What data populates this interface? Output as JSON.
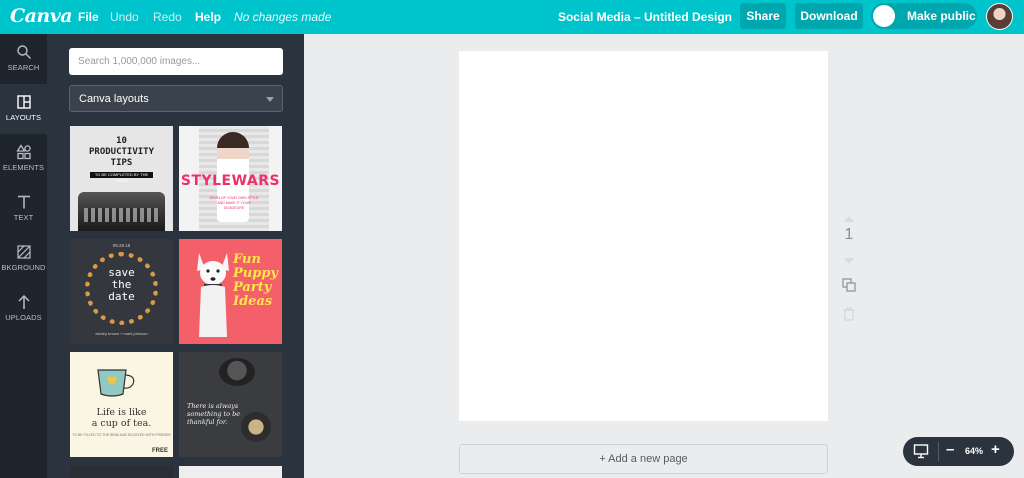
{
  "topbar": {
    "logo": "Canva",
    "menu": {
      "file": "File",
      "undo": "Undo",
      "redo": "Redo",
      "help": "Help",
      "status": "No changes made"
    },
    "document_title": "Social Media – Untitled Design",
    "share_label": "Share",
    "download_label": "Download",
    "make_public_label": "Make public",
    "accent_color": "#00c4cc"
  },
  "rail": {
    "items": [
      {
        "label": "SEARCH",
        "icon": "search-icon"
      },
      {
        "label": "LAYOUTS",
        "icon": "layouts-icon",
        "active": true
      },
      {
        "label": "ELEMENTS",
        "icon": "elements-icon"
      },
      {
        "label": "TEXT",
        "icon": "text-icon"
      },
      {
        "label": "BKGROUND",
        "icon": "background-icon"
      },
      {
        "label": "UPLOADS",
        "icon": "upload-icon"
      }
    ]
  },
  "panel": {
    "search_placeholder": "Search 1,000,000 images...",
    "layout_select": "Canva layouts",
    "tiles": {
      "productivity": {
        "title": "10 PRODUCTIVITY TIPS",
        "line1": "10",
        "line2": "PRODUCTIVITY",
        "line3": "TIPS",
        "strip": "TO BE COMPLETED BY THE WEEK"
      },
      "stylewars": {
        "title": "STYLEWARS",
        "small": "DEVELOP YOUR OWN STYLE AND MAKE IT YOUR SIGNATURE"
      },
      "save_the_date": {
        "date": "09.28.18",
        "line1": "save",
        "line2": "the",
        "line3": "date",
        "names": "ashley brown + mark johnson"
      },
      "puppy": {
        "line1": "Fun",
        "line2": "Puppy",
        "line3": "Party",
        "line4": "Ideas"
      },
      "tea": {
        "line1": "Life is like",
        "line2": "a cup of tea.",
        "tiny": "TO BE FILLED TO THE BRIM AND ENJOYED WITH FRIENDS",
        "badge": "FREE"
      },
      "thankful": {
        "quote": "There is always something to be thankful for."
      }
    }
  },
  "canvas": {
    "page_number": "1",
    "add_page_label": "+ Add a new page"
  },
  "zoom": {
    "value": "64%",
    "minus": "–",
    "plus": "+"
  }
}
